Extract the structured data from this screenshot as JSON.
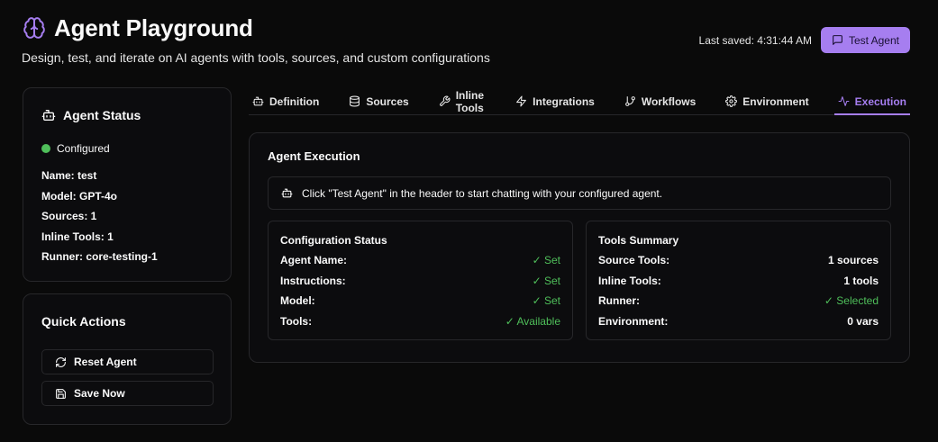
{
  "header": {
    "title": "Agent Playground",
    "subtitle": "Design, test, and iterate on AI agents with tools, sources, and custom configurations",
    "last_saved": "Last saved: 4:31:44 AM",
    "test_button": "Test Agent",
    "accent": "#a67ef0"
  },
  "status": {
    "title": "Agent Status",
    "state": "Configured",
    "state_color": "#4fbf5a",
    "items": [
      {
        "label": "Name: test"
      },
      {
        "label": "Model: GPT-4o"
      },
      {
        "label": "Sources: 1"
      },
      {
        "label": "Inline Tools: 1"
      },
      {
        "label": "Runner: core-testing-1"
      }
    ]
  },
  "quick_actions": {
    "title": "Quick Actions",
    "reset": "Reset Agent",
    "save": "Save Now"
  },
  "tabs": [
    {
      "label": "Definition",
      "icon": "bot-icon"
    },
    {
      "label": "Sources",
      "icon": "database-icon"
    },
    {
      "label": "Inline Tools",
      "icon": "wrench-icon"
    },
    {
      "label": "Integrations",
      "icon": "zap-icon"
    },
    {
      "label": "Workflows",
      "icon": "git-branch-icon"
    },
    {
      "label": "Environment",
      "icon": "gear-icon"
    },
    {
      "label": "Execution",
      "icon": "activity-icon",
      "active": true
    }
  ],
  "execution": {
    "title": "Agent Execution",
    "notice": "Click \"Test Agent\" in the header to start chatting with your configured agent.",
    "config": {
      "title": "Configuration Status",
      "rows": [
        {
          "k": "Agent Name:",
          "v": "✓ Set"
        },
        {
          "k": "Instructions:",
          "v": "✓ Set"
        },
        {
          "k": "Model:",
          "v": "✓ Set"
        },
        {
          "k": "Tools:",
          "v": "✓ Available"
        }
      ]
    },
    "tools": {
      "title": "Tools Summary",
      "rows": [
        {
          "k": "Source Tools:",
          "v": "1 sources"
        },
        {
          "k": "Inline Tools:",
          "v": "1 tools"
        },
        {
          "k": "Runner:",
          "v": "✓ Selected"
        },
        {
          "k": "Environment:",
          "v": "0 vars"
        }
      ]
    }
  }
}
